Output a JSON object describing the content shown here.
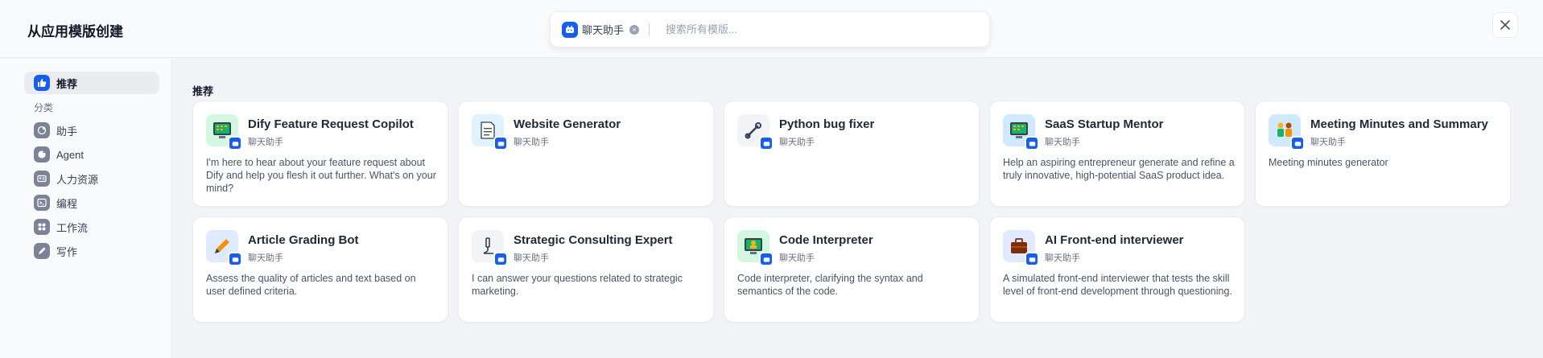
{
  "header": {
    "title": "从应用模版创建",
    "filter_chip": "聊天助手",
    "search_placeholder": "搜索所有模版..."
  },
  "sidebar": {
    "recommended_label": "推荐",
    "section_label": "分类",
    "categories": [
      {
        "label": "助手",
        "icon": "assistant-icon"
      },
      {
        "label": "Agent",
        "icon": "agent-icon"
      },
      {
        "label": "人力资源",
        "icon": "hr-icon"
      },
      {
        "label": "编程",
        "icon": "terminal-icon"
      },
      {
        "label": "工作流",
        "icon": "workflow-icon"
      },
      {
        "label": "写作",
        "icon": "pen-icon"
      }
    ]
  },
  "main": {
    "section_title": "推荐",
    "cards": [
      {
        "title": "Dify Feature Request Copilot",
        "type": "聊天助手",
        "description": "I'm here to hear about your feature request about Dify and help you flesh it out further. What's on your mind?",
        "icon": "monitor-icon",
        "icon_bg": "#d3f8df"
      },
      {
        "title": "Website Generator",
        "type": "聊天助手",
        "description": "",
        "icon": "document-icon",
        "icon_bg": "#e0f2fe"
      },
      {
        "title": "Python bug fixer",
        "type": "聊天助手",
        "description": "",
        "icon": "wrench-icon",
        "icon_bg": "#f2f4f7"
      },
      {
        "title": "SaaS Startup Mentor",
        "type": "聊天助手",
        "description": "Help an aspiring entrepreneur generate and refine a truly innovative, high-potential SaaS product idea.",
        "icon": "monitor-icon",
        "icon_bg": "#d1e9ff"
      },
      {
        "title": "Meeting Minutes and Summary",
        "type": "聊天助手",
        "description": "Meeting minutes generator",
        "icon": "people-icon",
        "icon_bg": "#d1e9ff"
      },
      {
        "title": "Article Grading Bot",
        "type": "聊天助手",
        "description": "Assess the quality of articles and text based on user defined criteria.",
        "icon": "pencil-icon",
        "icon_bg": "#e0eaff"
      },
      {
        "title": "Strategic Consulting Expert",
        "type": "聊天助手",
        "description": "I can answer your questions related to strategic marketing.",
        "icon": "microscope-icon",
        "icon_bg": "#f2f4f7"
      },
      {
        "title": "Code Interpreter",
        "type": "聊天助手",
        "description": "Code interpreter, clarifying the syntax and semantics of the code.",
        "icon": "monitor-icon",
        "icon_bg": "#d3f8df"
      },
      {
        "title": "AI Front-end interviewer",
        "type": "聊天助手",
        "description": "A simulated front-end interviewer that tests the skill level of front-end development through questioning.",
        "icon": "briefcase-icon",
        "icon_bg": "#e0eaff"
      }
    ]
  },
  "colors": {
    "accent": "#155eef",
    "background": "#f2f4f7",
    "card": "#ffffff"
  }
}
